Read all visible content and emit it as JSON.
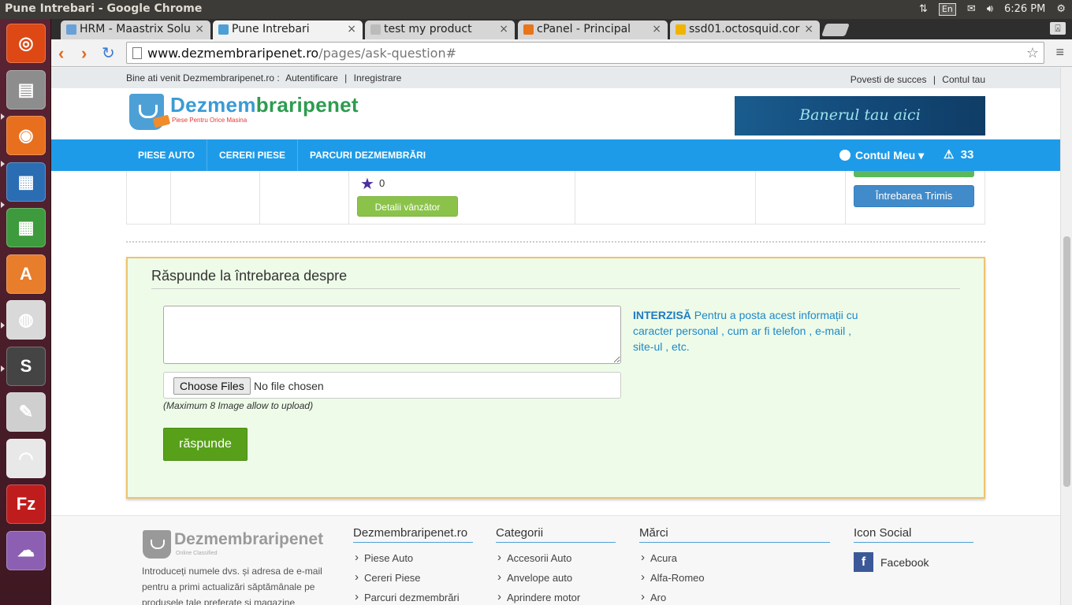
{
  "os": {
    "window_title": "Pune Intrebari - Google Chrome",
    "lang": "En",
    "time": "6:26 PM"
  },
  "launcher": [
    {
      "name": "ubuntu-dash-icon",
      "color": "#dd4814"
    },
    {
      "name": "files-icon",
      "color": "#8d8d8d"
    },
    {
      "name": "firefox-icon",
      "color": "#e76f1e"
    },
    {
      "name": "writer-icon",
      "color": "#2a6db3"
    },
    {
      "name": "calc-icon",
      "color": "#3d9b3d"
    },
    {
      "name": "software-center-icon",
      "color": "#e87d2b"
    },
    {
      "name": "chrome-icon",
      "color": "#d9d9d9"
    },
    {
      "name": "sublime-icon",
      "color": "#444444"
    },
    {
      "name": "text-editor-icon",
      "color": "#cfcfcf"
    },
    {
      "name": "pdf-reader-icon",
      "color": "#e8e8e8"
    },
    {
      "name": "filezilla-icon",
      "color": "#bf1d1d"
    },
    {
      "name": "pidgin-icon",
      "color": "#8c5fb3"
    }
  ],
  "tabs": [
    {
      "label": "HRM - Maastrix Solu",
      "active": false,
      "favicon_color": "#6aa0d8"
    },
    {
      "label": "Pune Intrebari",
      "active": true,
      "favicon_color": "#4da0d6"
    },
    {
      "label": "test my product",
      "active": false,
      "favicon_color": "#bbbbbb"
    },
    {
      "label": "cPanel - Principal",
      "active": false,
      "favicon_color": "#e8751a"
    },
    {
      "label": "ssd01.octosquid.cor",
      "active": false,
      "favicon_color": "#f0b400"
    }
  ],
  "address": {
    "host": "www.dezmembraripenet.ro",
    "path": "/pages/ask-question#"
  },
  "topbar": {
    "welcome": "Bine ati venit Dezmembraripenet.ro :",
    "login": "Autentificare",
    "register": "Inregistrare",
    "success_stories": "Povesti de succes",
    "account": "Contul tau"
  },
  "header": {
    "logo_part1": "Dezmem",
    "logo_part2": "braripenet",
    "logo_tagline": "Piese Pentru Orice Masina",
    "banner_text": "Banerul tau aici"
  },
  "nav": {
    "items": [
      "PIESE AUTO",
      "CERERI PIESE",
      "PARCURI DEZMEMBRĂRI"
    ],
    "account": "Contul Meu",
    "alert_count": "33"
  },
  "listing": {
    "rating": "0",
    "seller_details": "Detalii vânzător",
    "question_sent": "Întrebarea Trimis"
  },
  "answer": {
    "title": "Răspunde la întrebarea despre",
    "choose_files": "Choose Files",
    "no_file": "No file chosen",
    "max_hint": "(Maximum 8 Image allow to upload)",
    "submit": "răspunde",
    "warning_bold": "INTERZISĂ",
    "warning_text": " Pentru a posta acest informații cu caracter personal , cum ar fi telefon , e-mail , site-ul , etc."
  },
  "footer": {
    "logo_text": "Dezmembraripenet",
    "logo_sub": "Online Classified",
    "description": "Introduceți numele dvs. și adresa de e-mail pentru a primi actualizări săptămânale pe produsele tale preferate și magazine",
    "columns": [
      {
        "title": "Dezmembraripenet.ro",
        "links": [
          "Piese Auto",
          "Cereri Piese",
          "Parcuri dezmembrări"
        ]
      },
      {
        "title": "Categorii",
        "links": [
          "Accesorii Auto",
          "Anvelope auto",
          "Aprindere motor"
        ]
      },
      {
        "title": "Mărci",
        "links": [
          "Acura",
          "Alfa-Romeo",
          "Aro"
        ]
      }
    ],
    "social_title": "Icon Social",
    "facebook": "Facebook"
  }
}
